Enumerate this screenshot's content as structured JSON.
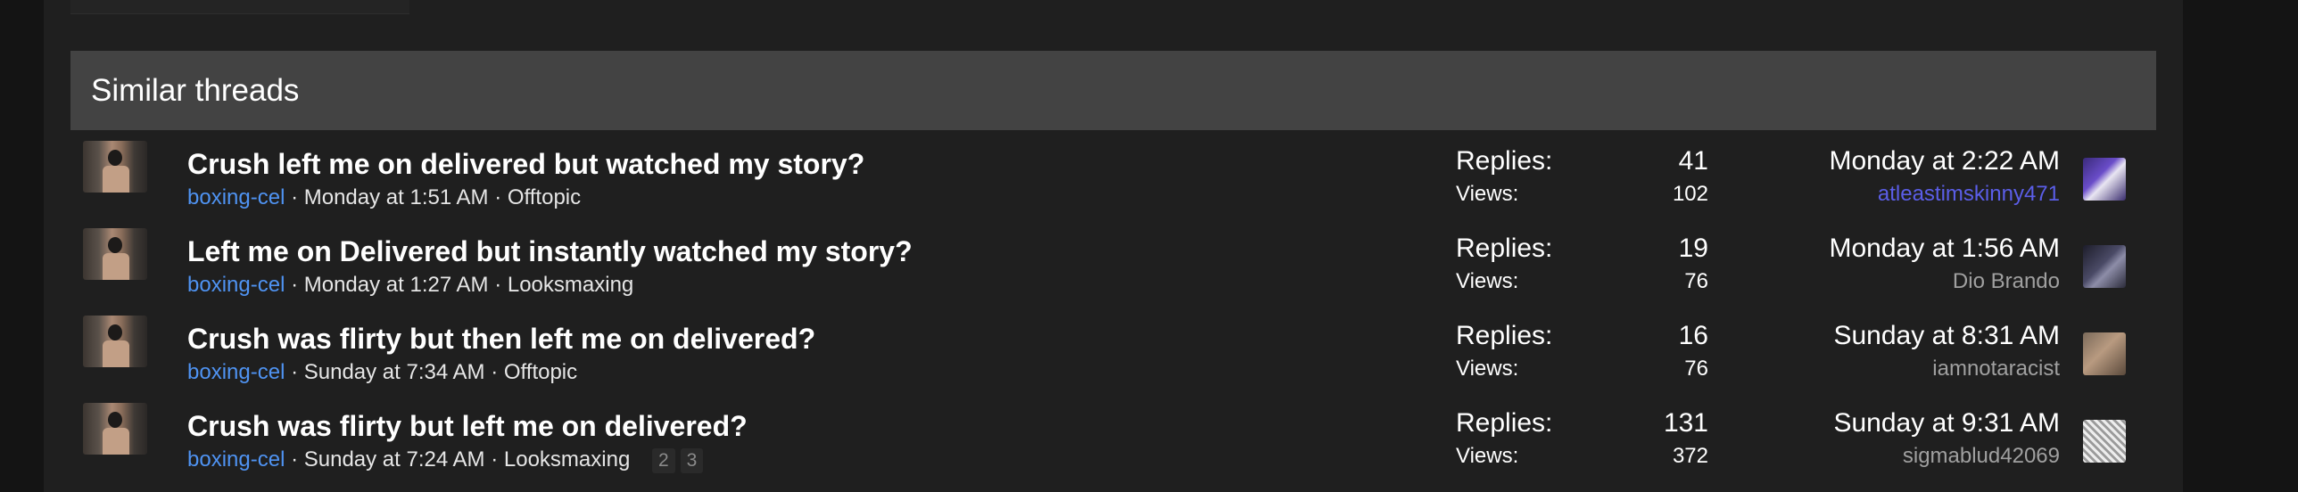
{
  "section": {
    "title": "Similar threads"
  },
  "labels": {
    "replies": "Replies:",
    "views": "Views:"
  },
  "threads": [
    {
      "title": "Crush left me on delivered but watched my story?",
      "author": "boxing-cel",
      "started": "Monday at 1:51 AM",
      "forum": "Offtopic",
      "replies": "41",
      "views": "102",
      "last_date": "Monday at 2:22 AM",
      "last_user": "atleastimskinny471",
      "last_user_color": "#5b5ee8"
    },
    {
      "title": "Left me on Delivered but instantly watched my story?",
      "author": "boxing-cel",
      "started": "Monday at 1:27 AM",
      "forum": "Looksmaxing",
      "replies": "19",
      "views": "76",
      "last_date": "Monday at 1:56 AM",
      "last_user": "Dio Brando",
      "last_user_color": "#a0a0a0"
    },
    {
      "title": "Crush was flirty but then left me on delivered?",
      "author": "boxing-cel",
      "started": "Sunday at 7:34 AM",
      "forum": "Offtopic",
      "replies": "16",
      "views": "76",
      "last_date": "Sunday at 8:31 AM",
      "last_user": "iamnotaracist",
      "last_user_color": "#a0a0a0"
    },
    {
      "title": "Crush was flirty but left me on delivered?",
      "author": "boxing-cel",
      "started": "Sunday at 7:24 AM",
      "forum": "Looksmaxing",
      "pages": [
        "2",
        "3"
      ],
      "replies": "131",
      "views": "372",
      "last_date": "Sunday at 9:31 AM",
      "last_user": "sigmablud42069",
      "last_user_color": "#a0a0a0"
    }
  ],
  "separator": " · "
}
